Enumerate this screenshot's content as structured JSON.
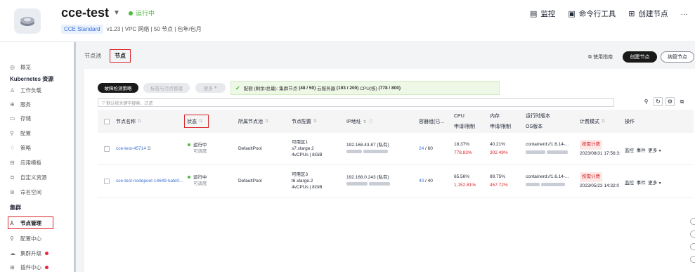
{
  "header": {
    "title": "cce-test",
    "status": "运行中",
    "tag": "CCE Standard",
    "subinfo": "v1.23 | VPC 网络 | 50 节点 | 包年/包月",
    "actions": [
      {
        "label": "监控",
        "icon": "monitor-icon"
      },
      {
        "label": "命令行工具",
        "icon": "terminal-icon"
      },
      {
        "label": "创建节点",
        "icon": "add-node-icon"
      }
    ],
    "more": "···"
  },
  "sidebar": {
    "items_top": [
      {
        "label": "概览",
        "icon": "overview-icon"
      }
    ],
    "group_k8s": "Kubernetes 资源",
    "items_k8s": [
      {
        "label": "工作负载"
      },
      {
        "label": "服务"
      },
      {
        "label": "存储"
      },
      {
        "label": "配置"
      },
      {
        "label": "策略"
      },
      {
        "label": "应用模板"
      },
      {
        "label": "自定义资源"
      },
      {
        "label": "命名空间"
      }
    ],
    "group_cluster": "集群",
    "items_cluster": [
      {
        "label": "节点管理"
      },
      {
        "label": "配置中心"
      },
      {
        "label": "集群升级"
      },
      {
        "label": "插件中心"
      }
    ]
  },
  "main": {
    "tabs": [
      "节点池",
      "节点"
    ],
    "guide": "使用指南",
    "create_btn": "创建节点",
    "manage_btn": "纳管节点",
    "toolbar": {
      "btn1": "故障检测策略",
      "btn2": "标签与污点管理",
      "btn3": "更多",
      "quota_prefix": "配额 (剩余/总量):",
      "quota_nodes_label": "集群节点",
      "quota_nodes": "(48 / 50)",
      "quota_servers_label": "云服务器",
      "quota_servers": "(193 / 200)",
      "quota_cpu_label": "CPU(核)",
      "quota_cpu": "(778 / 800)"
    },
    "search_placeholder": "默认按关键字搜索、过滤",
    "columns": {
      "name": "节点名称",
      "status": "状态",
      "pool": "所属节点池",
      "config": "节点配置",
      "ip": "IP地址",
      "pods": "容器组(已...",
      "cpu": "CPU",
      "cpu_sub": "申请/限制",
      "mem": "内存",
      "mem_sub": "申请/限制",
      "runtime": "运行时版本",
      "runtime_sub": "OS版本",
      "billing": "计费模式",
      "ops": "操作"
    },
    "rows": [
      {
        "name": "cce-test-45714",
        "status": "运行中",
        "schedulable": "可调度",
        "pool": "DefaultPool",
        "az": "可用区1",
        "flavor": "s7.xlarge.2",
        "spec": "4vCPUs | 8GiB",
        "ip": "192.168.43.87 (私有)",
        "pods": "24",
        "pods_total": "/ 60",
        "cpu_req": "18.37%",
        "cpu_lim": "778.83%",
        "mem_req": "40.21%",
        "mem_lim": "302.49%",
        "runtime": "containerd://1.6.14-...",
        "billing": "按需计费",
        "created": "2023/08/31 17:56:3:",
        "op1": "监控",
        "op2": "事件",
        "op3": "更多"
      },
      {
        "name": "cce-test-nodepool-14649-kate0...",
        "status": "运行中",
        "schedulable": "可调度",
        "pool": "DefaultPool",
        "az": "可用区3",
        "flavor": "t6.xlarge.2",
        "spec": "4vCPUs | 8GiB",
        "ip": "192.168.0.243 (私有)",
        "pods": "40",
        "pods_total": "/ 40",
        "cpu_req": "65.56%",
        "cpu_lim": "1,152.81%",
        "mem_req": "89.75%",
        "mem_lim": "457.72%",
        "runtime": "containerd://1.6.14-...",
        "billing": "按需计费",
        "created": "2023/05/23 14:32:0",
        "op1": "监控",
        "op2": "事件",
        "op3": "更多"
      }
    ]
  }
}
